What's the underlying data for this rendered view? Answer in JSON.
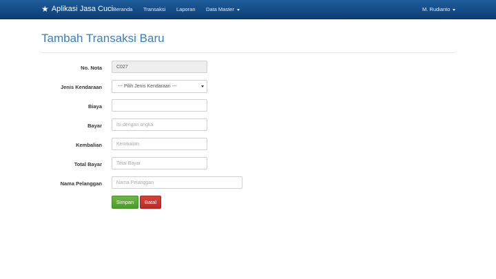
{
  "navbar": {
    "brand": "Aplikasi Jasa Cuci",
    "items": [
      {
        "label": "Beranda"
      },
      {
        "label": "Transaksi"
      },
      {
        "label": "Laporan"
      },
      {
        "label": "Data Master"
      }
    ],
    "user": "M. Rudianto"
  },
  "page": {
    "title": "Tambah Transaksi Baru"
  },
  "form": {
    "no_nota": {
      "label": "No. Nota",
      "value": "C027"
    },
    "jenis_kendaraan": {
      "label": "Jenis Kendaraan",
      "selected": "--- Pilih Jenis Kendaraan ---"
    },
    "biaya": {
      "label": "Biaya",
      "value": ""
    },
    "bayar": {
      "label": "Bayar",
      "placeholder": "Isi dengan angka"
    },
    "kembalian": {
      "label": "Kembalian",
      "placeholder": "Kembalian"
    },
    "total_bayar": {
      "label": "Total Bayar",
      "placeholder": "Total Bayar"
    },
    "nama_pelanggan": {
      "label": "Nama Pelanggan",
      "placeholder": "Nama Pelanggan"
    },
    "save_label": "Simpan",
    "cancel_label": "Batal"
  },
  "colors": {
    "navbar": "#124a85",
    "title": "#3a7fbf",
    "save_button": "#5aa833",
    "cancel_button": "#c9302c"
  }
}
